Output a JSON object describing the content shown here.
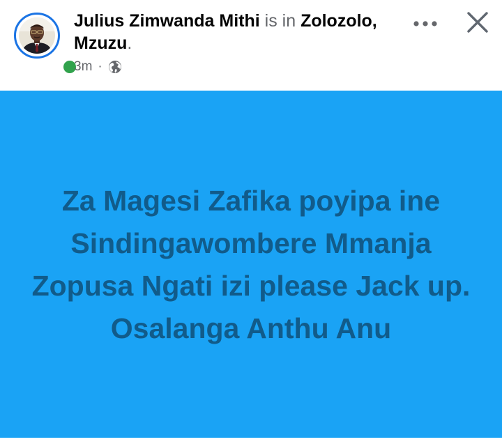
{
  "post": {
    "author": "Julius Zimwanda Mithi",
    "connector": "is in",
    "location_line1": "Zolozolo,",
    "location_line2": "Mzuzu",
    "period": ".",
    "timestamp": "3m",
    "separator": "·",
    "privacy_icon": "globe-icon",
    "body_text": "Za Magesi Zafika poyipa ine Sindingawombere Mmanja Zopusa Ngati izi please Jack up. Osalanga Anthu Anu",
    "background_color": "#1aa3f5",
    "text_color": "#115b8a"
  },
  "actions": {
    "more_icon": "more-icon",
    "close_icon": "close-icon"
  },
  "colors": {
    "avatar_ring": "#1b74e4",
    "online_status": "#31a24c",
    "author_text": "#050505",
    "secondary_text": "#65676b"
  }
}
